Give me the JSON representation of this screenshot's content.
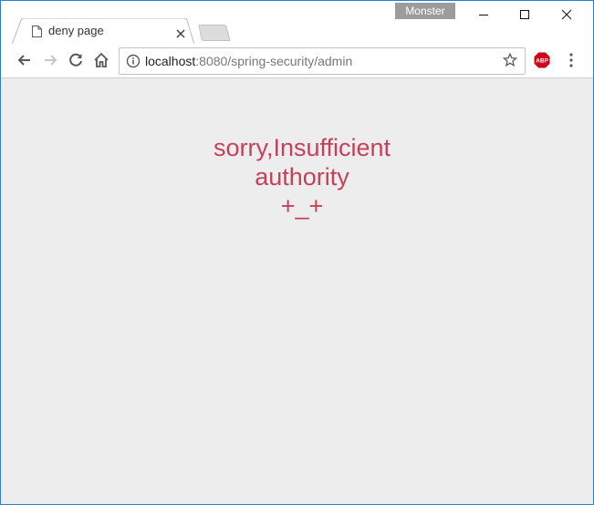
{
  "window": {
    "profile_name": "Monster",
    "tab": {
      "title": "deny page"
    },
    "controls": [
      "minimize-icon",
      "maximize-icon",
      "close-icon"
    ]
  },
  "toolbar": {
    "url_host": "localhost",
    "url_rest": ":8080/spring-security/admin",
    "icons": [
      "back-arrow-icon",
      "forward-arrow-icon",
      "reload-icon",
      "home-icon",
      "info-icon",
      "star-icon",
      "adblock-plus-icon",
      "menu-dots-icon"
    ],
    "adblock_label": "ABP"
  },
  "page": {
    "message_line1": "sorry,Insufficient",
    "message_line2": "authority",
    "message_line3": "+_+"
  },
  "colors": {
    "message": "#c4415c",
    "page_background": "#ededed",
    "window_border": "#2b7cd3",
    "adblock": "#d0021b"
  }
}
